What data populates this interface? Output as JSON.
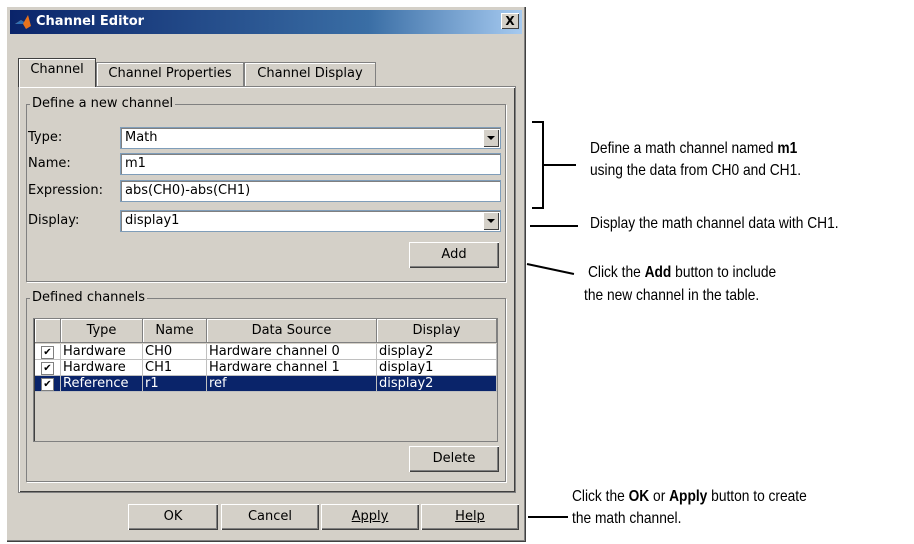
{
  "window": {
    "title": "Channel Editor",
    "close_label": "X"
  },
  "tabs": [
    {
      "label": "Channel"
    },
    {
      "label": "Channel Properties"
    },
    {
      "label": "Channel Display"
    }
  ],
  "define_group": {
    "legend": "Define a new channel",
    "type_label": "Type:",
    "type_value": "Math",
    "name_label": "Name:",
    "name_value": "m1",
    "expression_label": "Expression:",
    "expression_value": "abs(CH0)-abs(CH1)",
    "display_label": "Display:",
    "display_value": "display1",
    "add_label": "Add"
  },
  "defined_group": {
    "legend": "Defined channels",
    "columns": [
      "Type",
      "Name",
      "Data Source",
      "Display"
    ],
    "rows": [
      {
        "checked": true,
        "type": "Hardware",
        "name": "CH0",
        "source": "Hardware channel 0",
        "display": "display2"
      },
      {
        "checked": true,
        "type": "Hardware",
        "name": "CH1",
        "source": "Hardware channel 1",
        "display": "display1"
      },
      {
        "checked": true,
        "type": "Reference",
        "name": "r1",
        "source": "ref",
        "display": "display2"
      }
    ],
    "delete_label": "Delete"
  },
  "footer": {
    "ok": "OK",
    "cancel": "Cancel",
    "apply": "Apply",
    "help": "Help"
  },
  "annotations": {
    "a1_l1_pre": "Define a math channel named ",
    "a1_l1_bold": "m1",
    "a1_l2": "using the data from CH0 and CH1.",
    "a2": "Display the math channel data with CH1.",
    "a3_l1_pre": "Click the ",
    "a3_l1_bold": "Add",
    "a3_l1_post": " button to include",
    "a3_l2": "the new channel in the table.",
    "a4_l1_pre": "Click the ",
    "a4_l1_ok": "OK",
    "a4_l1_mid": " or ",
    "a4_l1_apply": "Apply",
    "a4_l1_post": " button to create",
    "a4_l2": "the math channel."
  },
  "colors": {
    "title_bar": "#0a246a",
    "selection": "#0a246a",
    "dialog_face": "#d4d0c8"
  }
}
